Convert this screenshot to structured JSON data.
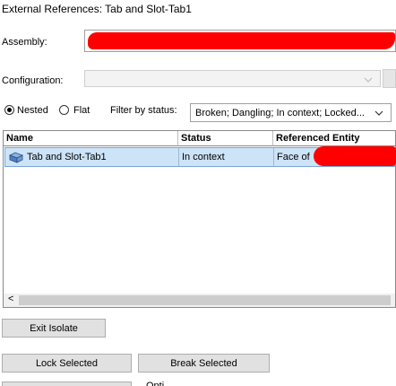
{
  "window": {
    "title": "External References: Tab and Slot-Tab1"
  },
  "assembly": {
    "label": "Assembly:"
  },
  "configuration": {
    "label": "Configuration:",
    "value": ""
  },
  "view_mode": {
    "options": [
      {
        "label": "Nested",
        "checked": true
      },
      {
        "label": "Flat",
        "checked": false
      }
    ]
  },
  "filter": {
    "label": "Filter by status:",
    "value": "Broken; Dangling; In context; Locked..."
  },
  "table": {
    "columns": [
      "Name",
      "Status",
      "Referenced Entity"
    ],
    "rows": [
      {
        "name": "Tab and Slot-Tab1",
        "status": "In context",
        "entity": "Face of",
        "icon": "part-icon"
      }
    ],
    "scroll_left_glyph": "<"
  },
  "buttons": {
    "exit_isolate": "Exit Isolate",
    "lock_selected": "Lock Selected",
    "break_selected": "Break Selected"
  },
  "partial_text": {
    "bottom_right": "Opti"
  },
  "colors": {
    "selection": "#cde3f7",
    "redaction": "#ff0000",
    "button_face": "#e1e1e1"
  }
}
